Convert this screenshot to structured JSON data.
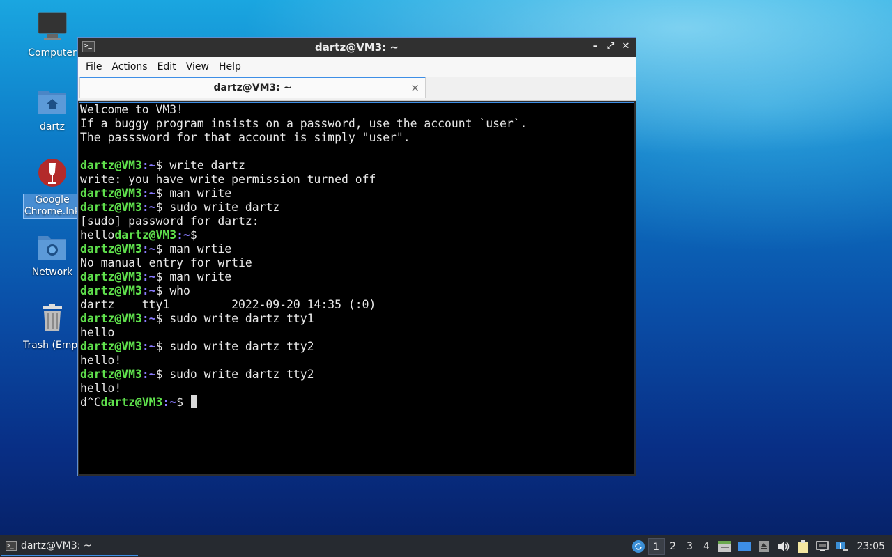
{
  "desktop": {
    "icons": [
      {
        "label": "Computer",
        "icon": "computer-icon"
      },
      {
        "label": "dartz",
        "icon": "home-folder-icon"
      },
      {
        "label": "Google\nChrome.lnk",
        "icon": "wine-icon"
      },
      {
        "label": "Network",
        "icon": "network-folder-icon"
      },
      {
        "label": "Trash (Empty",
        "icon": "trash-icon"
      }
    ]
  },
  "window": {
    "title": "dartz@VM3: ~",
    "menu": [
      "File",
      "Actions",
      "Edit",
      "View",
      "Help"
    ],
    "tab_title": "dartz@VM3: ~",
    "tab_close": "×",
    "controls": {
      "minimize": "–",
      "maximize": "⤢",
      "close": "✕"
    }
  },
  "terminal": {
    "prompt_user": "dartz@VM3",
    "prompt_path": ":~",
    "prompt_symbol": "$ ",
    "lines": [
      {
        "text": "Welcome to VM3!"
      },
      {
        "text": "If a buggy program insists on a password, use the account `user`."
      },
      {
        "text": "The passsword for that account is simply \"user\"."
      },
      {
        "text": ""
      },
      {
        "prompt": true,
        "cmd": "write dartz"
      },
      {
        "text": "write: you have write permission turned off"
      },
      {
        "prompt": true,
        "cmd": "man write"
      },
      {
        "prompt": true,
        "cmd": "sudo write dartz"
      },
      {
        "text": "[sudo] password for dartz:"
      },
      {
        "prefix": "hello",
        "prompt": true,
        "cmd": ""
      },
      {
        "prompt": true,
        "cmd": "man wrtie"
      },
      {
        "text": "No manual entry for wrtie"
      },
      {
        "prompt": true,
        "cmd": "man write"
      },
      {
        "prompt": true,
        "cmd": "who"
      },
      {
        "text": "dartz    tty1         2022-09-20 14:35 (:0)"
      },
      {
        "prompt": true,
        "cmd": "sudo write dartz tty1"
      },
      {
        "text": "hello"
      },
      {
        "prompt": true,
        "cmd": "sudo write dartz tty2"
      },
      {
        "text": "hello!"
      },
      {
        "prompt": true,
        "cmd": "sudo write dartz tty2"
      },
      {
        "text": "hello!"
      },
      {
        "prefix": "d^C",
        "prompt": true,
        "cmd": "",
        "cursor": true
      }
    ]
  },
  "taskbar": {
    "task_label": "dartz@VM3: ~",
    "workspaces": [
      "1",
      "2",
      "3",
      "4"
    ],
    "active_workspace": "1",
    "clock": "23:05"
  },
  "colors": {
    "prompt_user": "#5fe04c",
    "prompt_path": "#8a7cff",
    "accent": "#3d8ee6"
  }
}
